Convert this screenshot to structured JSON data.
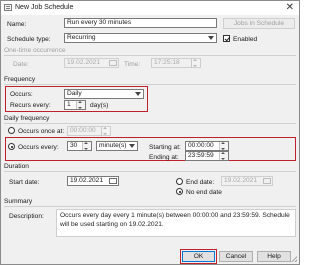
{
  "window": {
    "title": "New Job Schedule"
  },
  "name_row": {
    "label": "Name:",
    "value": "Run every 30 minutes",
    "jobs_button": "Jobs in Schedule"
  },
  "type_row": {
    "label": "Schedule type:",
    "value": "Recurring",
    "enabled_label": "Enabled",
    "enabled_checked": true
  },
  "one_time": {
    "header": "One-time occurrence",
    "date_label": "Date:",
    "date_value": "19.02.2021",
    "time_label": "Time:",
    "time_value": "17:25:18"
  },
  "frequency": {
    "header": "Frequency",
    "occurs_label": "Occurs:",
    "occurs_value": "Daily",
    "recurs_label": "Recurs every:",
    "recurs_value": "1",
    "recurs_unit": "day(s)"
  },
  "daily": {
    "header": "Daily frequency",
    "once_label": "Occurs once at:",
    "once_value": "00:00:00",
    "once_selected": false,
    "every_label": "Occurs every:",
    "every_value": "30",
    "every_unit": "minute(s)",
    "every_selected": true,
    "starting_label": "Starting at:",
    "starting_value": "00:00:00",
    "ending_label": "Ending at:",
    "ending_value": "23:59:59"
  },
  "duration": {
    "header": "Duration",
    "start_label": "Start date:",
    "start_value": "19.02.2021",
    "end_label": "End date:",
    "end_value": "19.02.2021",
    "end_selected": false,
    "noend_label": "No end date",
    "noend_selected": true
  },
  "summary": {
    "header": "Summary",
    "desc_label": "Description:",
    "text": "Occurs every day every 1 minute(s) between 00:00:00 and 23:59:59. Schedule will be used starting on 19.02.2021."
  },
  "buttons": {
    "ok": "OK",
    "cancel": "Cancel",
    "help": "Help"
  },
  "colors": {
    "highlight": "#c0202a",
    "focus_border": "#0078d7",
    "dialog_bg": "#f0f0f0"
  }
}
